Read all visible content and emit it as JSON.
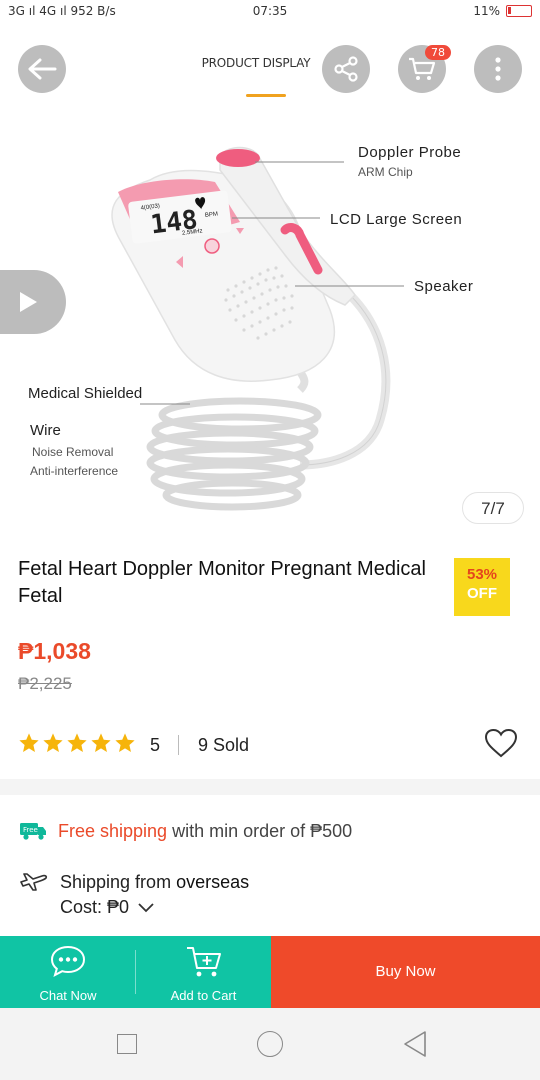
{
  "status_bar": {
    "left": "3G ıl 4G ıl  952 B/s",
    "time": "07:35",
    "battery": "11%"
  },
  "header": {
    "tab_label": "PRODUCT DISPLAY",
    "cart_count": "78"
  },
  "product_image": {
    "counter": "7/7",
    "callouts": {
      "doppler_probe": "Doppler Probe",
      "arm_chip": "ARM Chip",
      "lcd": "LCD Large Screen",
      "speaker": "Speaker",
      "shielded": "Medical Shielded",
      "wire": "Wire",
      "noise": "Noise Removal",
      "anti": "Anti-interference"
    },
    "screen_reading": "148",
    "screen_top": "4(0(03)",
    "screen_bpm": "BPM",
    "screen_bottom": "2.5MHz"
  },
  "product": {
    "title": "Fetal Heart Doppler Monitor Pregnant Medical Fetal",
    "discount_pct": "53%",
    "discount_off": "OFF",
    "price": "₱1,038",
    "old_price": "₱2,225",
    "rating": "5",
    "rating_stars": 5,
    "sold": "9 Sold"
  },
  "shipping": {
    "free_badge": "Free",
    "free_text": "Free shipping",
    "min_order": " with min order of ₱500",
    "from_prefix": "Shipping from ",
    "from_place": "overseas",
    "cost_label": "Cost: ",
    "cost_value": "₱0"
  },
  "actions": {
    "chat": "Chat Now",
    "add_to_cart": "Add to Cart",
    "buy_now": "Buy Now"
  },
  "colors": {
    "accent": "#ea4a2a",
    "teal": "#10c4a4",
    "underline": "#f0a21f",
    "star": "#f6b40b",
    "badge": "#f8d81c"
  }
}
